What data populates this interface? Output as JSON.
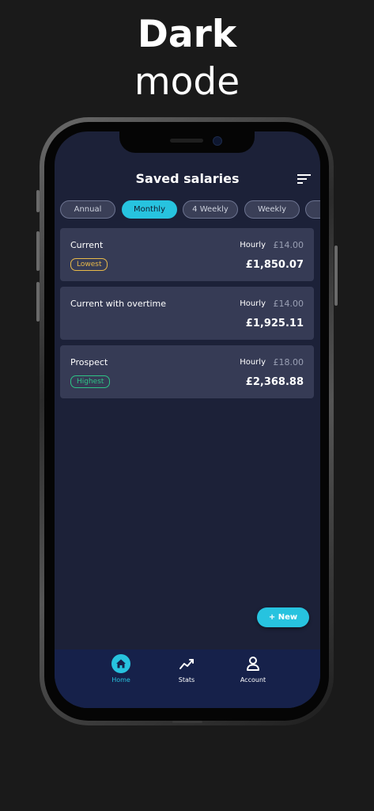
{
  "hero": {
    "line1": "Dark",
    "line2": "mode"
  },
  "header": {
    "title": "Saved salaries"
  },
  "tabs": [
    {
      "label": "Annual"
    },
    {
      "label": "Monthly",
      "active": true
    },
    {
      "label": "4 Weekly"
    },
    {
      "label": "Weekly"
    }
  ],
  "salaries": [
    {
      "name": "Current",
      "rate_label": "Hourly",
      "rate": "£14.00",
      "total": "£1,850.07",
      "badge": "Lowest"
    },
    {
      "name": "Current with overtime",
      "rate_label": "Hourly",
      "rate": "£14.00",
      "total": "£1,925.11"
    },
    {
      "name": "Prospect",
      "rate_label": "Hourly",
      "rate": "£18.00",
      "total": "£2,368.88",
      "badge": "Highest"
    }
  ],
  "fab": {
    "label": "+ New"
  },
  "nav": [
    {
      "label": "Home",
      "icon": "home-icon",
      "active": true
    },
    {
      "label": "Stats",
      "icon": "stats-icon"
    },
    {
      "label": "Account",
      "icon": "account-icon"
    }
  ],
  "colors": {
    "accent": "#27c3df",
    "background": "#1c2138",
    "card": "#363b55",
    "lowest": "#e8b94a",
    "highest": "#2ec486"
  }
}
